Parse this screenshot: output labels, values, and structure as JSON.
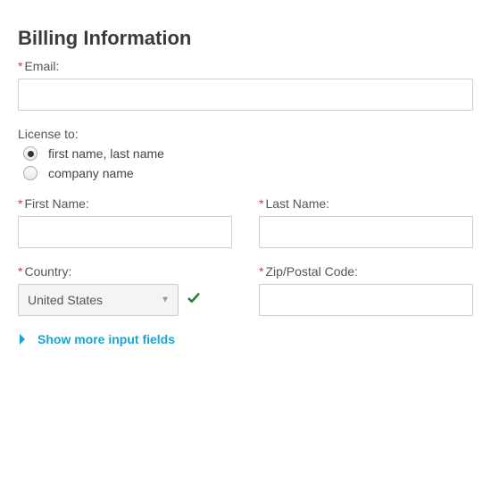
{
  "title": "Billing Information",
  "email": {
    "label": "Email:",
    "value": "",
    "required": true
  },
  "license": {
    "label": "License to:",
    "options": [
      {
        "label": "first name, last name",
        "selected": true
      },
      {
        "label": "company name",
        "selected": false
      }
    ]
  },
  "first_name": {
    "label": "First Name:",
    "value": "",
    "required": true
  },
  "last_name": {
    "label": "Last Name:",
    "value": "",
    "required": true
  },
  "country": {
    "label": "Country:",
    "value": "United States",
    "required": true,
    "valid": true
  },
  "zip": {
    "label": "Zip/Postal Code:",
    "value": "",
    "required": true
  },
  "show_more": "Show more input fields"
}
